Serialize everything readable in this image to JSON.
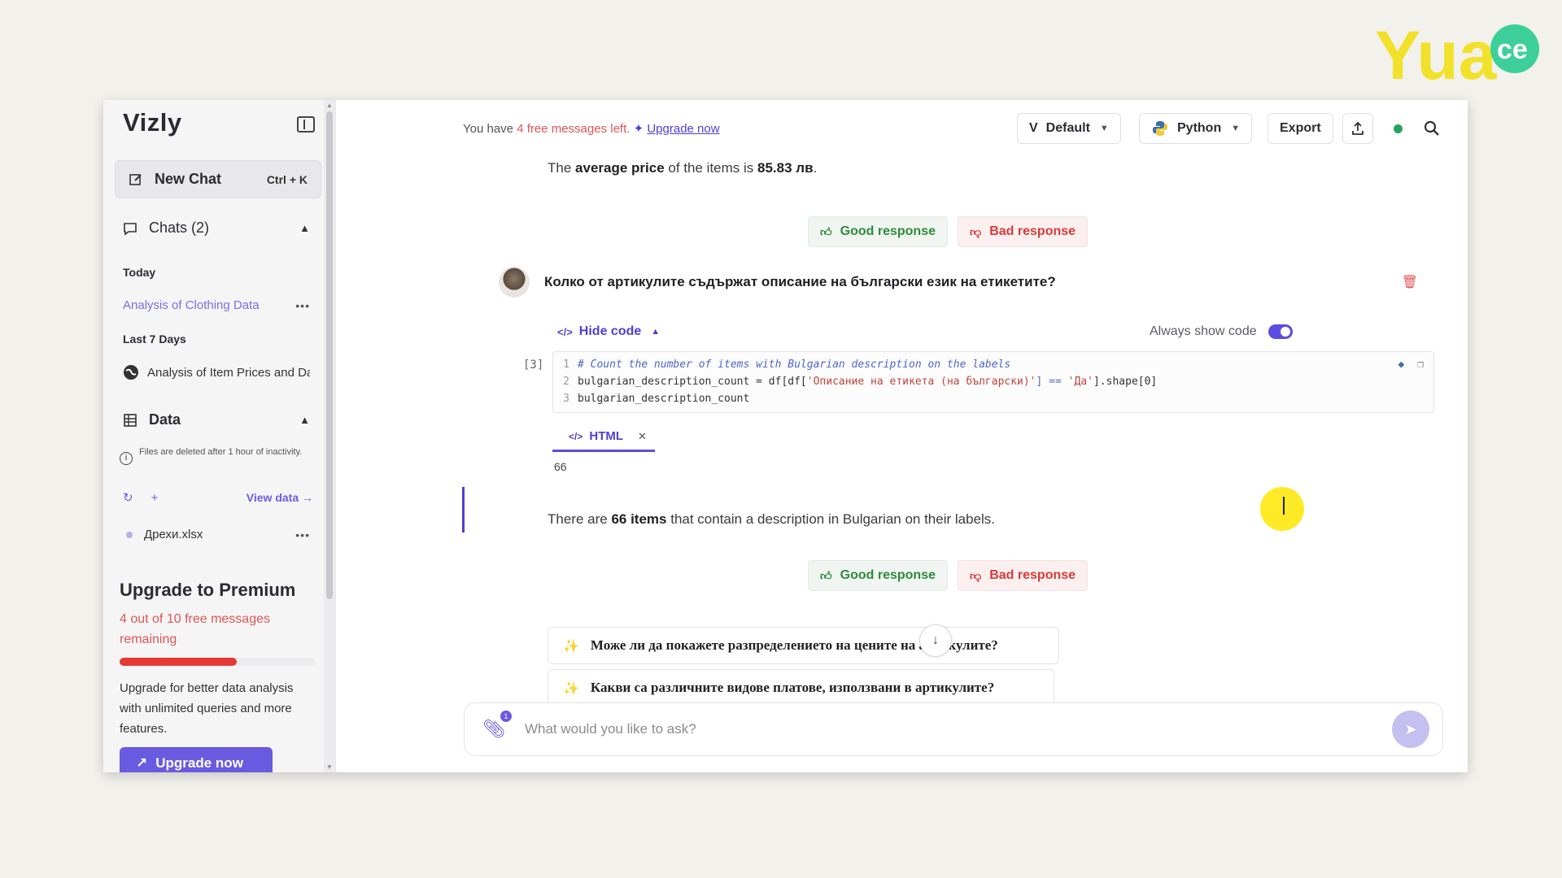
{
  "overlay_logo": {
    "text": "Yuace",
    "colors": {
      "yellow": "#f2e12a",
      "green": "#3ccf9a"
    }
  },
  "sidebar": {
    "brand": "Vizly",
    "new_chat": {
      "label": "New Chat",
      "shortcut": "Ctrl + K"
    },
    "chats": {
      "title": "Chats (2)"
    },
    "groups": [
      {
        "label": "Today",
        "items": [
          {
            "title": "Analysis of Clothing Data",
            "active": true
          }
        ]
      },
      {
        "label": "Last 7 Days",
        "items": [
          {
            "title": "Analysis of Item Prices and Data"
          }
        ]
      }
    ],
    "data": {
      "title": "Data",
      "note": "Files are deleted after 1 hour of inactivity.",
      "view_data": "View data",
      "files": [
        {
          "name": "Дрехи.xlsx"
        }
      ]
    },
    "premium": {
      "title": "Upgrade to Premium",
      "remaining": "4 out of 10 free messages remaining",
      "progress": 0.6,
      "description": "Upgrade for better data analysis with unlimited queries and more features.",
      "button": "Upgrade now"
    }
  },
  "topbar": {
    "notice_prefix": "You have",
    "notice_count": "4 free messages left.",
    "notice_link": "Upgrade now",
    "model": "Default",
    "language": "Python",
    "export": "Export",
    "status_color": "#22a55a"
  },
  "conversation": {
    "answer1": {
      "pre": "The",
      "bold1": "average price",
      "mid": "of the items is",
      "bold2": "85.83 лв",
      "post": "."
    },
    "feedback": {
      "good": "Good response",
      "bad": "Bad response"
    },
    "question": "Колко от артикулите съдържат описание на български език на етикетите?",
    "code": {
      "toggle_label": "Hide code",
      "always_show_label": "Always show code",
      "cell_index": "[3]",
      "lines": [
        {
          "n": "1",
          "comment": "# Count the number of items with Bulgarian description on the labels"
        },
        {
          "n": "2",
          "a": "bulgarian_description_count = df[df[",
          "s1": "'Описание на етикета (на български)'",
          "b": "] == ",
          "s2": "'Да'",
          "c": "].shape[0]"
        },
        {
          "n": "3",
          "a": "bulgarian_description_count"
        }
      ],
      "output_tab": "HTML",
      "output_value": "66"
    },
    "answer2": {
      "pre": "There are",
      "bold": "66 items",
      "post": "that contain a description in Bulgarian on their labels."
    },
    "suggestions": [
      "Може ли да покажете разпределението на цените на артикулите?",
      "Какви са различните видове платове, използвани в артикулите?"
    ]
  },
  "composer": {
    "placeholder": "What would you like to ask?",
    "attach_badge": "1"
  }
}
